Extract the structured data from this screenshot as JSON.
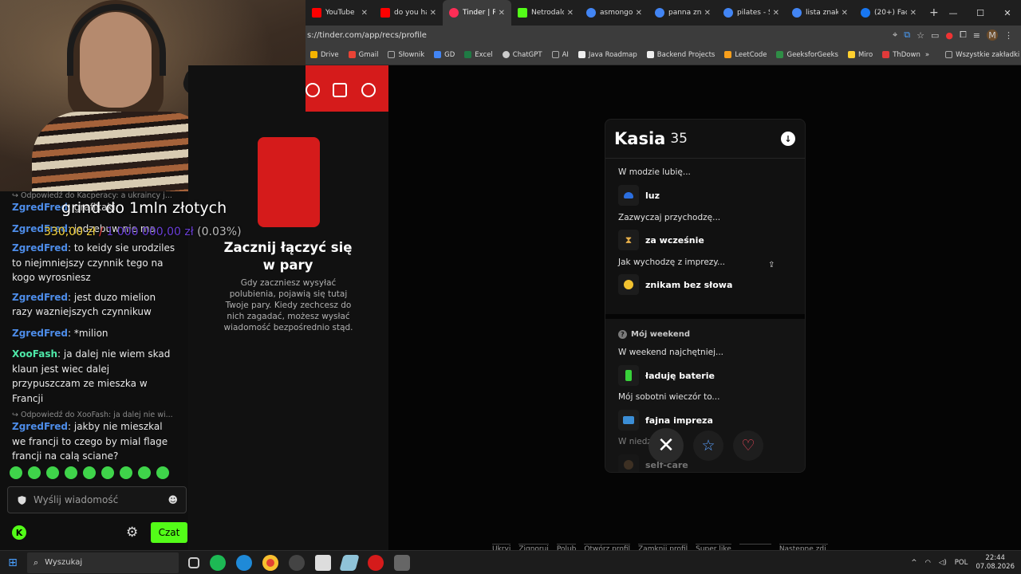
{
  "browser": {
    "tabs": [
      {
        "label": "YouTube",
        "color": "#ff0000",
        "active": false
      },
      {
        "label": "do you hav",
        "color": "#ff0000",
        "active": false
      },
      {
        "label": "Tinder | Ra",
        "color": "#fd2d56",
        "active": true
      },
      {
        "label": "Netrodalo",
        "color": "#53fc18",
        "active": false
      },
      {
        "label": "asmongold",
        "color": "#4285f4",
        "active": false
      },
      {
        "label": "panna znak",
        "color": "#4285f4",
        "active": false
      },
      {
        "label": "pilates - Sz",
        "color": "#4285f4",
        "active": false
      },
      {
        "label": "lista znakó",
        "color": "#4285f4",
        "active": false
      },
      {
        "label": "(20+) Face",
        "color": "#1877f2",
        "active": false
      }
    ],
    "url": "s://tinder.com/app/recs/profile",
    "profile_initial": "M",
    "bookmarks": [
      {
        "label": "Drive",
        "color": "#f4b400"
      },
      {
        "label": "Gmail",
        "color": "#ea4335"
      },
      {
        "label": "Słownik",
        "color": "#999999"
      },
      {
        "label": "GD",
        "color": "#4285f4"
      },
      {
        "label": "Excel",
        "color": "#1f7a44"
      },
      {
        "label": "ChatGPT",
        "color": "#cccccc"
      },
      {
        "label": "AI",
        "color": "#999999"
      },
      {
        "label": "Java Roadmap",
        "color": "#222222"
      },
      {
        "label": "Backend Projects",
        "color": "#ffffff"
      },
      {
        "label": "LeetCode",
        "color": "#f89f1b"
      },
      {
        "label": "GeeksforGeeks",
        "color": "#2f8d46"
      },
      {
        "label": "Miro",
        "color": "#ffd02f"
      },
      {
        "label": "ThDown",
        "color": "#e03a3a"
      }
    ],
    "all_bookmarks": "Wszystkie zakładki"
  },
  "overlay": {
    "title": "grind do 1mln złotych",
    "current": "330,00 zł",
    "separator": " / ",
    "goal": "1 000 000,00 zł",
    "percent": " (0.03%)"
  },
  "chat": {
    "reply1": "↪ Odpowiedź do Kacperacy: a ukraincy j...",
    "m1_user": "ZgredFred",
    "m1_text": ": grafikaki",
    "m2_user": "ZgredFred",
    "m2_text": ": jedzebuw nie ma",
    "m3_user": "ZgredFred",
    "m3_text": ": to keidy sie urodziles to niejmniejszy czynnik tego na kogo wyrosniesz",
    "m4_user": "ZgredFred",
    "m4_text": ": jest duzo mielion razy wazniejszych czynnikuw",
    "m5_user": "ZgredFred",
    "m5_text": ": *milion",
    "m6_user": "XooFash",
    "m6_text": ": ja dalej nie wiem skad klaun jest wiec dalej przypuszczam ze mieszka w Francji",
    "reply2": "↪ Odpowiedź do XooFash: ja dalej nie wi...",
    "m7_user": "ZgredFred",
    "m7_text": ": jakby nie mieszkal we francji to czego by mial flage francji na calą sciane?",
    "input_placeholder": "Wyślij wiadomość",
    "send_label": "Czat",
    "kick_initial": "K"
  },
  "tinder_left": {
    "title": "Zacznij łączyć się w pary",
    "description": "Gdy zaczniesz wysyłać polubienia, pojawią się tutaj Twoje pary. Kiedy zechcesz do nich zagadać, możesz wysłać wiadomość bezpośrednio stąd."
  },
  "profile": {
    "name": "Kasia",
    "age": "35",
    "q1": "W modzie lubię...",
    "a1": "luz",
    "q2": "Zazwyczaj przychodzę...",
    "a2": "za wcześnie",
    "q3": "Jak wychodzę z imprezy...",
    "a3": "znikam bez słowa",
    "section2_title": "Mój weekend",
    "q4": "W weekend najchętniej...",
    "a4": "ładuję baterie",
    "q5": "Mój sobotni wieczór to...",
    "a5": "fajna impreza",
    "q6": "W niedz",
    "q6_tail": "che",
    "a6": "self-care"
  },
  "kbd_hints": [
    "Ukryj",
    "Zignoruj",
    "Polub",
    "Otwórz profil",
    "Zamknij profil",
    "Super like",
    "",
    "Następne zdj."
  ],
  "taskbar": {
    "search_placeholder": "Wyszukaj",
    "lang": "POL",
    "time": "22:44",
    "date": "07.08.2026"
  }
}
